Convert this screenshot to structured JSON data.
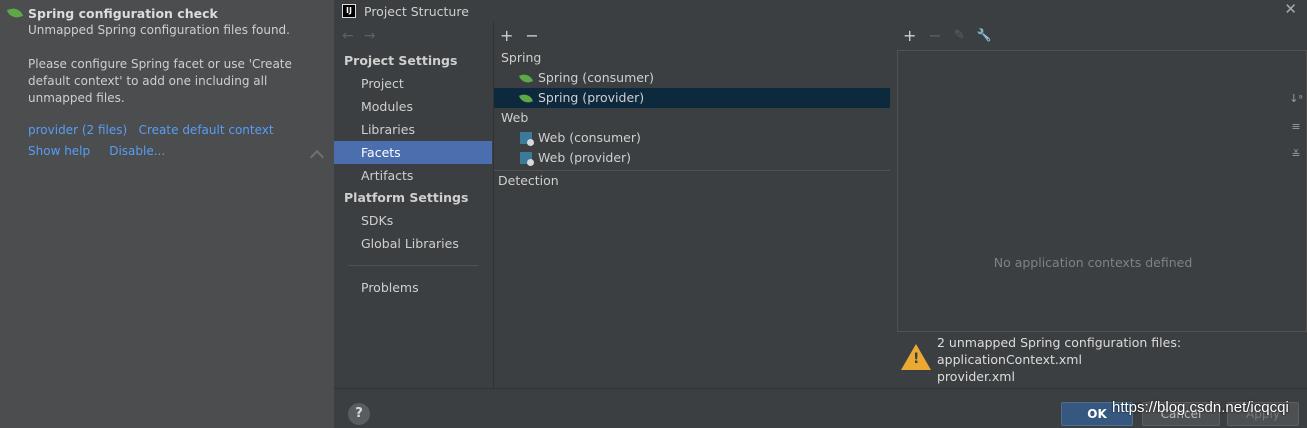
{
  "notification": {
    "title": "Spring configuration check",
    "line1": "Unmapped Spring configuration files found.",
    "line2": "Please configure Spring facet or use 'Create default context' to add one including all unmapped files.",
    "provider_link": "provider",
    "provider_count": "(2 files)",
    "create_link": "Create default context",
    "show_help": "Show help",
    "disable": "Disable..."
  },
  "dialog": {
    "title": "Project Structure",
    "app_icon": "IJ",
    "close": "✕"
  },
  "nav": {
    "back": "←",
    "forward": "→",
    "project_settings": "Project Settings",
    "project_items": [
      "Project",
      "Modules",
      "Libraries",
      "Facets",
      "Artifacts"
    ],
    "selected": "Facets",
    "platform_settings": "Platform Settings",
    "platform_items": [
      "SDKs",
      "Global Libraries"
    ],
    "problems": "Problems"
  },
  "facets": {
    "add": "+",
    "remove": "−",
    "spring_group": "Spring",
    "spring_items": [
      "Spring (consumer)",
      "Spring (provider)"
    ],
    "web_group": "Web",
    "web_items": [
      "Web (consumer)",
      "Web (provider)"
    ],
    "detection": "Detection"
  },
  "contexts": {
    "add": "+",
    "remove": "−",
    "edit": "✎",
    "wrench": "🔧",
    "empty": "No application contexts defined",
    "warning_line1": "2 unmapped Spring configuration files:",
    "warning_line2": "applicationContext.xml",
    "warning_line3": "provider.xml"
  },
  "buttons": {
    "help": "?",
    "ok": "OK",
    "cancel": "Cancel",
    "apply": "Apply"
  },
  "watermark": "https://blog.csdn.net/icqcqi",
  "colors": {
    "selection": "#4b6eaf",
    "tree_selection": "#0d293e",
    "link": "#589df6",
    "spring_leaf": "#5da847",
    "warning": "#e9a932"
  }
}
